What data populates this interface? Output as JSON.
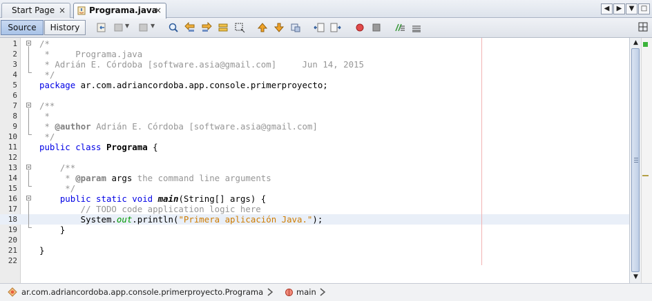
{
  "tabs": [
    {
      "label": "Start Page",
      "close": "×",
      "active": false
    },
    {
      "label": "Programa.java",
      "close": "×",
      "active": true
    }
  ],
  "window_controls": [
    "◀",
    "▶",
    "▼",
    "□"
  ],
  "toolbar": {
    "source_label": "Source",
    "history_label": "History",
    "icons": [
      "last-edit-icon",
      "back-icon",
      "forward-icon",
      "find-selection-icon",
      "find-previous-icon",
      "find-next-icon",
      "toggle-highlight-icon",
      "rect-selection-icon",
      "previous-bookmark-icon",
      "next-bookmark-icon",
      "toggle-bookmark-icon",
      "shift-left-icon",
      "shift-right-icon",
      "start-macro-icon",
      "stop-macro-icon",
      "comment-icon",
      "uncomment-icon"
    ],
    "split_icon": "split-window-icon"
  },
  "editor": {
    "file": "Programa.java",
    "lines": [
      {
        "n": "1",
        "segs": [
          [
            "cm",
            "/*"
          ]
        ]
      },
      {
        "n": "2",
        "segs": [
          [
            "cm",
            " *     Programa.java"
          ]
        ]
      },
      {
        "n": "3",
        "segs": [
          [
            "cm",
            " * Adrián E. Córdoba [software.asia@gmail.com]     Jun 14, 2015"
          ]
        ]
      },
      {
        "n": "4",
        "segs": [
          [
            "cm",
            " */"
          ]
        ]
      },
      {
        "n": "5",
        "segs": [
          [
            "kw",
            "package"
          ],
          [
            "",
            " ar.com.adriancordoba.app.console.primerproyecto;"
          ]
        ]
      },
      {
        "n": "6",
        "segs": []
      },
      {
        "n": "7",
        "segs": [
          [
            "cm",
            "/**"
          ]
        ]
      },
      {
        "n": "8",
        "segs": [
          [
            "cm",
            " *"
          ]
        ]
      },
      {
        "n": "9",
        "segs": [
          [
            "cm",
            " * "
          ],
          [
            "tag",
            "@author"
          ],
          [
            "cm",
            " Adrián E. Córdoba [software.asia@gmail.com]"
          ]
        ]
      },
      {
        "n": "10",
        "segs": [
          [
            "cm",
            " */"
          ]
        ]
      },
      {
        "n": "11",
        "segs": [
          [
            "kw",
            "public class"
          ],
          [
            "",
            " "
          ],
          [
            "b",
            "Programa"
          ],
          [
            "",
            " {"
          ]
        ]
      },
      {
        "n": "12",
        "segs": []
      },
      {
        "n": "13",
        "segs": [
          [
            "cm",
            "    /**"
          ]
        ]
      },
      {
        "n": "14",
        "segs": [
          [
            "cm",
            "     * "
          ],
          [
            "tag",
            "@param"
          ],
          [
            "",
            " args"
          ],
          [
            "cm",
            " the command line arguments"
          ]
        ]
      },
      {
        "n": "15",
        "segs": [
          [
            "cm",
            "     */"
          ]
        ]
      },
      {
        "n": "16",
        "segs": [
          [
            "",
            "    "
          ],
          [
            "kw",
            "public static void"
          ],
          [
            "",
            " "
          ],
          [
            "bi",
            "main"
          ],
          [
            "",
            "(String[] args) {"
          ]
        ]
      },
      {
        "n": "17",
        "segs": [
          [
            "cm",
            "        // TODO code application logic here"
          ]
        ]
      },
      {
        "n": "18",
        "segs": [
          [
            "",
            "        System."
          ],
          [
            "fld",
            "out"
          ],
          [
            "",
            ".println("
          ],
          [
            "str",
            "\"Primera aplicación Java.\""
          ],
          [
            "",
            ");"
          ]
        ],
        "current": true
      },
      {
        "n": "19",
        "segs": [
          [
            "",
            "    }"
          ]
        ]
      },
      {
        "n": "20",
        "segs": []
      },
      {
        "n": "21",
        "segs": [
          [
            "",
            "}"
          ]
        ]
      },
      {
        "n": "22",
        "segs": []
      }
    ]
  },
  "scrollbar": {
    "up": "▲",
    "down": "▼"
  },
  "breadcrumb": {
    "class_path": "ar.com.adriancordoba.app.console.primerproyecto.Programa",
    "method": "main"
  },
  "colors": {
    "keyword": "#0000e6",
    "comment": "#969696",
    "string": "#ce7b00",
    "field": "#009900",
    "current_line": "#e9eff8"
  }
}
